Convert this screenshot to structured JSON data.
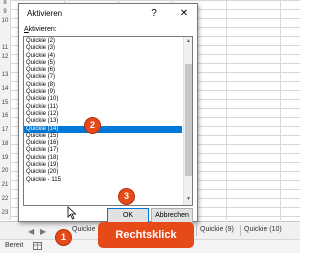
{
  "dialog": {
    "title": "Aktivieren",
    "help": "?",
    "close": "✕",
    "label_prefix": "A",
    "label_rest": "ktivieren:",
    "items": [
      "Quickie (2)",
      "Quickie (3)",
      "Quickie (4)",
      "Quickie (5)",
      "Quickie (6)",
      "Quickie (7)",
      "Quickie (8)",
      "Quickie (9)",
      "Quickie (10)",
      "Quickie (11)",
      "Quickie (12)",
      "Quickie (13)",
      "Quickie (14)",
      "Quickie (15)",
      "Quickie (16)",
      "Quickie (17)",
      "Quickie (18)",
      "Quickie (19)",
      "Quickie (20)",
      "Quickie - 115"
    ],
    "selected_index": 12,
    "ok": "OK",
    "cancel": "Abbrechen"
  },
  "sheet": {
    "rows": [
      "8",
      "9",
      "10",
      "11",
      "12",
      "13",
      "14",
      "15",
      "16",
      "17",
      "18",
      "19",
      "20",
      "21",
      "22",
      "23"
    ],
    "tabs": [
      "Quickie",
      "Quickie (9)",
      "Quickie (10)"
    ],
    "nav_prev": "◀",
    "nav_next": "▶",
    "status": "Bereit"
  },
  "annotations": {
    "step1": "1",
    "step2": "2",
    "step3": "3",
    "right_click": "Rechtsklick"
  },
  "colors": {
    "selection": "#0078d7",
    "annotation": "#e64a19"
  }
}
